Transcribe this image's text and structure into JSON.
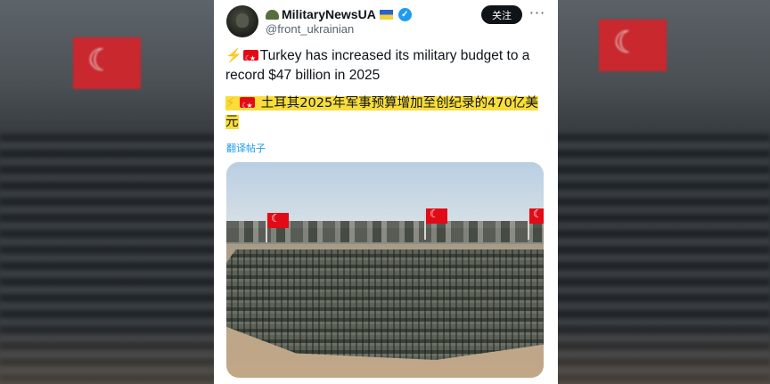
{
  "author": {
    "display_name": "MilitaryNewsUA",
    "handle": "@front_ukrainian",
    "name_prefix_icon": "military-helmet-icon",
    "name_suffix_icon": "ukraine-flag-icon",
    "verified_icon": "verified-badge-icon"
  },
  "actions": {
    "follow_label": "关注",
    "more_label": "···"
  },
  "tweet": {
    "text_en": "Turkey has increased its military budget to a record $47 billion in 2025",
    "text_en_prefix_icons": [
      "lightning-icon",
      "turkey-flag-icon"
    ],
    "text_zh": "土耳其2025年军事预算增加至创纪录的470亿美元",
    "text_zh_prefix_icons": [
      "lightning-icon",
      "turkey-flag-icon"
    ],
    "translate_label": "翻译帖子",
    "media_description_icon": "parade-photo"
  },
  "colors": {
    "accent": "#1d9bf0",
    "highlight": "#f9dd3a",
    "turkey_red": "#e30a17"
  }
}
